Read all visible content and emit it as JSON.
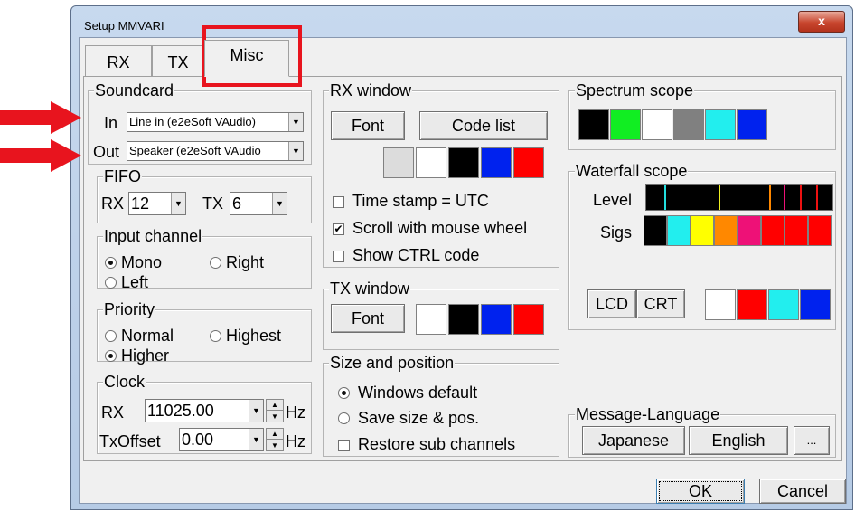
{
  "window": {
    "title": "Setup MMVARI",
    "close_label": "x"
  },
  "tabs": [
    {
      "label": "RX"
    },
    {
      "label": "TX"
    },
    {
      "label": "Misc"
    }
  ],
  "soundcard": {
    "label": "Soundcard",
    "in_label": "In",
    "in_value": "Line in (e2eSoft VAudio)",
    "out_label": "Out",
    "out_value": "Speaker (e2eSoft VAudio"
  },
  "fifo": {
    "label": "FIFO",
    "rx_label": "RX",
    "rx_value": "12",
    "tx_label": "TX",
    "tx_value": "6"
  },
  "input_channel": {
    "label": "Input channel",
    "options": [
      {
        "label": "Mono",
        "checked": true
      },
      {
        "label": "Right",
        "checked": false
      },
      {
        "label": "Left",
        "checked": false
      }
    ]
  },
  "priority": {
    "label": "Priority",
    "options": [
      {
        "label": "Normal",
        "checked": false
      },
      {
        "label": "Highest",
        "checked": false
      },
      {
        "label": "Higher",
        "checked": true
      }
    ]
  },
  "clock": {
    "label": "Clock",
    "rx_label": "RX",
    "rx_value": "11025.00",
    "rx_unit": "Hz",
    "txoffset_label": "TxOffset",
    "txoffset_value": "0.00",
    "txoffset_unit": "Hz"
  },
  "rx_window": {
    "label": "RX window",
    "font_label": "Font",
    "codelist_label": "Code list",
    "colors": [
      "#dcdcdc",
      "#ffffff",
      "#000000",
      "#0022ee",
      "#ff0000"
    ],
    "checkboxes": [
      {
        "label": "Time stamp = UTC",
        "checked": false
      },
      {
        "label": "Scroll with mouse wheel",
        "checked": true
      },
      {
        "label": "Show CTRL code",
        "checked": false
      }
    ]
  },
  "tx_window": {
    "label": "TX window",
    "font_label": "Font",
    "colors": [
      "#ffffff",
      "#000000",
      "#0022ee",
      "#ff0000"
    ]
  },
  "size_position": {
    "label": "Size and position",
    "options": [
      {
        "label": "Windows default",
        "checked": true
      },
      {
        "label": "Save size & pos.",
        "checked": false
      }
    ],
    "restore_label": "Restore sub channels",
    "restore_checked": false
  },
  "spectrum": {
    "label": "Spectrum scope",
    "colors": [
      "#000000",
      "#11ee22",
      "#ffffff",
      "#808080",
      "#22eeee",
      "#0022ee"
    ]
  },
  "waterfall": {
    "label": "Waterfall scope",
    "level_label": "Level",
    "sigs_label": "Sigs",
    "level_marks": [
      "#22dddd",
      "#eeee22",
      "#ff8800",
      "#ee1177",
      "#ee1111",
      "#ee1111"
    ],
    "sigs_colors": [
      "#000000",
      "#22eeee",
      "#ffff00",
      "#ff8800",
      "#ee1177",
      "#ff0000",
      "#ff0000",
      "#ff0000"
    ],
    "lcd_label": "LCD",
    "crt_label": "CRT",
    "colors": [
      "#ffffff",
      "#ff0000",
      "#22eeee",
      "#0022ee"
    ]
  },
  "message_language": {
    "label": "Message-Language",
    "japanese_label": "Japanese",
    "english_label": "English",
    "more_label": "..."
  },
  "footer": {
    "ok_label": "OK",
    "cancel_label": "Cancel"
  },
  "annotation_color": "#e8141e"
}
